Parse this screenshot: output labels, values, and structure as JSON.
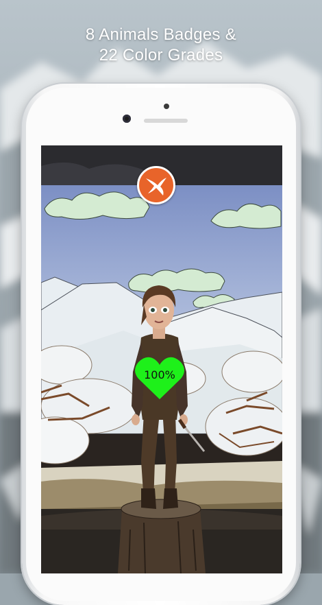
{
  "caption": {
    "line1": "8 Animals Badges &",
    "line2": "22 Color Grades"
  },
  "game": {
    "badge_icon": "swallow-bird-icon",
    "health_percent": "100%",
    "health_value": 100,
    "colors": {
      "badge": "#e8642a",
      "heart": "#1ef01a",
      "sky": "#9fb0d8",
      "clouds": "#d4ebd2"
    }
  }
}
